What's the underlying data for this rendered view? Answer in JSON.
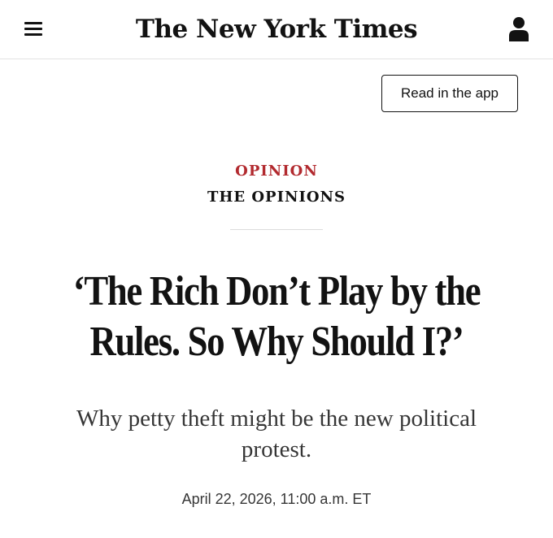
{
  "header": {
    "masthead": "The New York Times",
    "menu_icon": "hamburger-menu-icon",
    "account_icon": "account-person-icon"
  },
  "app_button": {
    "label": "Read in the app"
  },
  "article": {
    "kicker": "OPINION",
    "section": "THE OPINIONS",
    "headline": "‘The Rich Don’t Play by the Rules. So Why Should I?’",
    "dek": "Why petty theft might be the new political protest.",
    "dateline": "April 22, 2026, 11:00 a.m. ET"
  },
  "colors": {
    "kicker": "#b22a2f",
    "text": "#121212",
    "secondary_text": "#363636"
  }
}
